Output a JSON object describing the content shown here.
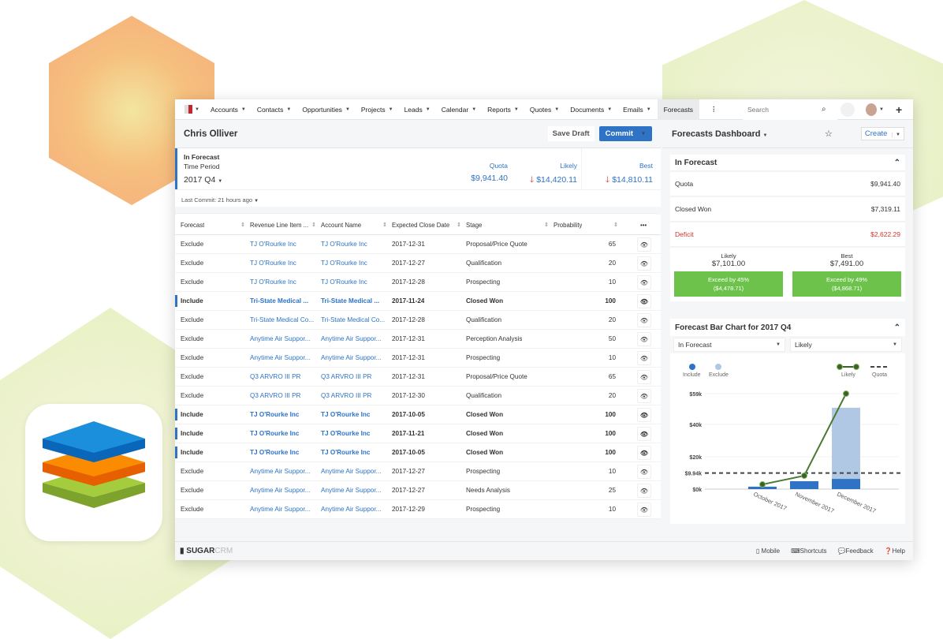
{
  "nav": {
    "items": [
      "Accounts",
      "Contacts",
      "Opportunities",
      "Projects",
      "Leads",
      "Calendar",
      "Reports",
      "Quotes",
      "Documents",
      "Emails"
    ],
    "active": "Forecasts",
    "search_placeholder": "Search"
  },
  "header": {
    "user": "Chris Olliver",
    "save_draft": "Save Draft",
    "commit": "Commit"
  },
  "summary": {
    "title": "In Forecast",
    "time_period_label": "Time Period",
    "time_period": "2017 Q4",
    "quota_label": "Quota",
    "quota": "$9,941.40",
    "likely_label": "Likely",
    "likely": "$14,420.11",
    "best_label": "Best",
    "best": "$14,810.11",
    "last_commit": "Last Commit: 21 hours ago"
  },
  "table": {
    "columns": [
      "Forecast",
      "Revenue Line Item ...",
      "Account Name",
      "Expected Close Date",
      "Stage",
      "Probability"
    ],
    "rows": [
      [
        "Exclude",
        "TJ O'Rourke Inc",
        "TJ O'Rourke Inc",
        "2017-12-31",
        "Proposal/Price Quote",
        "65"
      ],
      [
        "Exclude",
        "TJ O'Rourke Inc",
        "TJ O'Rourke Inc",
        "2017-12-27",
        "Qualification",
        "20"
      ],
      [
        "Exclude",
        "TJ O'Rourke Inc",
        "TJ O'Rourke Inc",
        "2017-12-28",
        "Prospecting",
        "10"
      ],
      [
        "Include",
        "Tri-State Medical ...",
        "Tri-State Medical ...",
        "2017-11-24",
        "Closed Won",
        "100"
      ],
      [
        "Exclude",
        "Tri-State Medical Co...",
        "Tri-State Medical Co...",
        "2017-12-28",
        "Qualification",
        "20"
      ],
      [
        "Exclude",
        "Anytime Air Suppor...",
        "Anytime Air Suppor...",
        "2017-12-31",
        "Perception Analysis",
        "50"
      ],
      [
        "Exclude",
        "Anytime Air Suppor...",
        "Anytime Air Suppor...",
        "2017-12-31",
        "Prospecting",
        "10"
      ],
      [
        "Exclude",
        "Q3 ARVRO III PR",
        "Q3 ARVRO III PR",
        "2017-12-31",
        "Proposal/Price Quote",
        "65"
      ],
      [
        "Exclude",
        "Q3 ARVRO III PR",
        "Q3 ARVRO III PR",
        "2017-12-30",
        "Qualification",
        "20"
      ],
      [
        "Include",
        "TJ O'Rourke Inc",
        "TJ O'Rourke Inc",
        "2017-10-05",
        "Closed Won",
        "100"
      ],
      [
        "Include",
        "TJ O'Rourke Inc",
        "TJ O'Rourke Inc",
        "2017-11-21",
        "Closed Won",
        "100"
      ],
      [
        "Include",
        "TJ O'Rourke Inc",
        "TJ O'Rourke Inc",
        "2017-10-05",
        "Closed Won",
        "100"
      ],
      [
        "Exclude",
        "Anytime Air Suppor...",
        "Anytime Air Suppor...",
        "2017-12-27",
        "Prospecting",
        "10"
      ],
      [
        "Exclude",
        "Anytime Air Suppor...",
        "Anytime Air Suppor...",
        "2017-12-27",
        "Needs Analysis",
        "25"
      ],
      [
        "Exclude",
        "Anytime Air Suppor...",
        "Anytime Air Suppor...",
        "2017-12-29",
        "Prospecting",
        "10"
      ]
    ]
  },
  "dashboard": {
    "title": "Forecasts Dashboard",
    "create": "Create",
    "in_forecast": {
      "title": "In Forecast",
      "quota_label": "Quota",
      "quota": "$9,941.40",
      "closed_won_label": "Closed Won",
      "closed_won": "$7,319.11",
      "deficit_label": "Deficit",
      "deficit": "$2,622.29",
      "likely_label": "Likely",
      "likely": "$7,101.00",
      "likely_exceed": "Exceed by 45%",
      "likely_exceed_amt": "($4,478.71)",
      "best_label": "Best",
      "best": "$7,491.00",
      "best_exceed": "Exceed by 49%",
      "best_exceed_amt": "($4,868.71)"
    },
    "chart_title": "Forecast Bar Chart for 2017 Q4",
    "filter1": "In Forecast",
    "filter2": "Likely"
  },
  "chart_data": {
    "type": "bar",
    "categories": [
      "October 2017",
      "November 2017",
      "December 2017"
    ],
    "series": [
      {
        "name": "Include",
        "values": [
          1.5,
          4.9,
          6.3
        ]
      },
      {
        "name": "Exclude",
        "values": [
          0,
          0,
          44
        ]
      },
      {
        "name": "Likely",
        "type": "line",
        "values": [
          2.9,
          8.3,
          59
        ]
      },
      {
        "name": "Quota",
        "type": "dashed",
        "value": 9.94
      }
    ],
    "yticks": [
      "$0k",
      "$9.94k",
      "$20k",
      "$40k",
      "$59k"
    ],
    "ylim": [
      0,
      59
    ],
    "units": "$k",
    "legend": "top",
    "stacked": true
  },
  "footer": {
    "brand": "SUGARCRM",
    "mobile": "Mobile",
    "shortcuts": "Shortcuts",
    "feedback": "Feedback",
    "help": "Help"
  },
  "colors": {
    "accent": "#2e73c6",
    "include": "#2e73c6",
    "exclude": "#b0c8e4",
    "likely": "#4a7a32",
    "deficit": "#d0342c",
    "green": "#6cc24a"
  }
}
